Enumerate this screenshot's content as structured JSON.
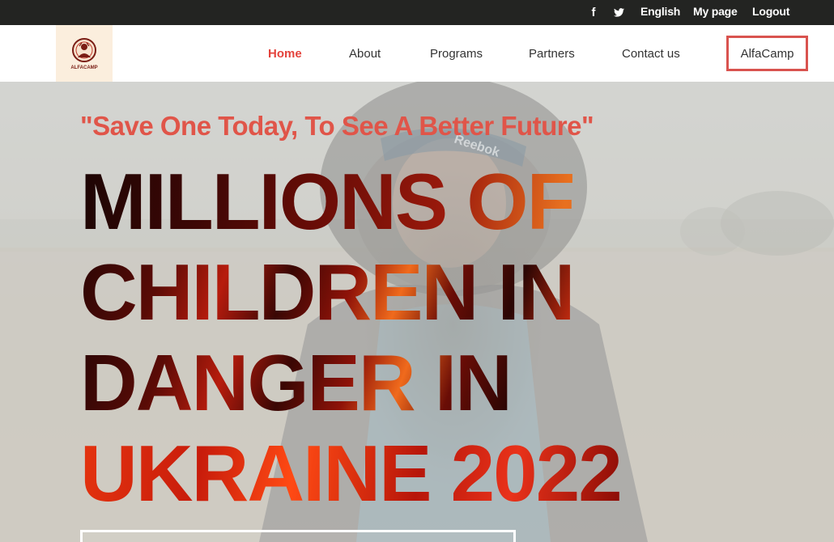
{
  "topbar": {
    "social": [
      {
        "icon": "facebook-icon",
        "glyph": "f"
      },
      {
        "icon": "twitter-icon"
      }
    ],
    "language": "English",
    "my_page": "My page",
    "logout": "Logout"
  },
  "navbar": {
    "logo_text": "ALFACAMP",
    "links": [
      {
        "label": "Home",
        "active": true
      },
      {
        "label": "About"
      },
      {
        "label": "Programs"
      },
      {
        "label": "Partners"
      },
      {
        "label": "Contact us"
      }
    ],
    "highlight_link": "AlfaCamp"
  },
  "hero": {
    "tagline": "\"Save One Today, To See A Better Future\"",
    "headline_lines": [
      "MILLIONS OF",
      "CHILDREN IN",
      "DANGER IN",
      "UKRAINE 2022"
    ],
    "photo_text": "Reebok"
  },
  "colors": {
    "topbar_bg": "#232422",
    "accent": "#e4433c",
    "tagline": "#e05549",
    "highlight_border": "#d9534f",
    "logo_bg": "#fbeedd"
  }
}
